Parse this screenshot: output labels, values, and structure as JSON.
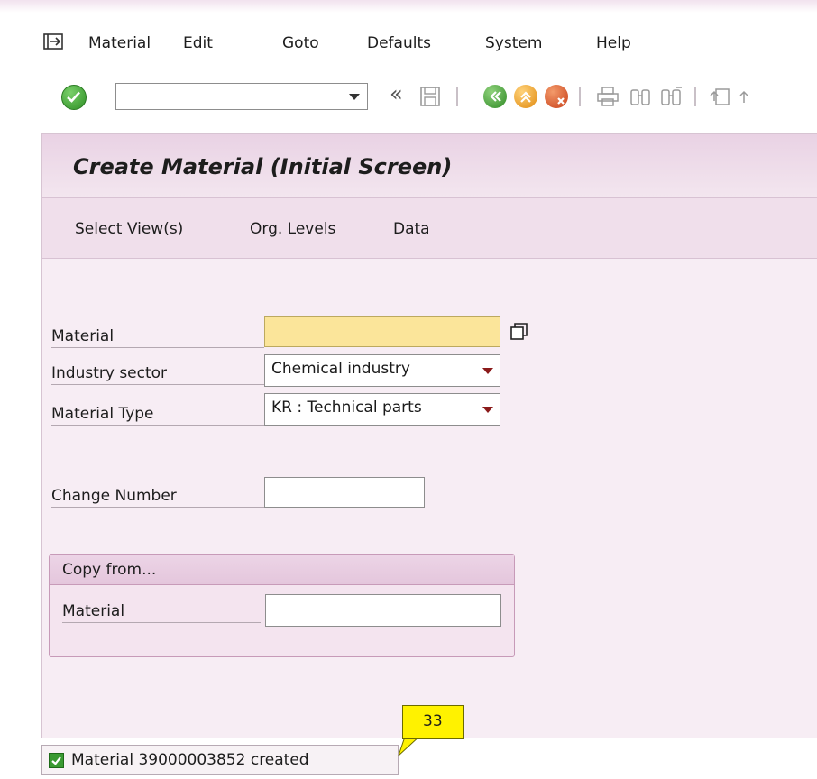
{
  "menu": {
    "items": [
      "Material",
      "Edit",
      "Goto",
      "Defaults",
      "System",
      "Help"
    ]
  },
  "toolbar": {
    "command_value": "",
    "icons": [
      "enter-icon",
      "command-field",
      "back-chevron-icon",
      "save-icon",
      "back-icon",
      "exit-icon",
      "cancel-icon",
      "print-icon",
      "find-icon",
      "find-next-icon",
      "first-page-icon"
    ]
  },
  "screen": {
    "title": "Create Material (Initial Screen)"
  },
  "actions": {
    "select_views": "Select View(s)",
    "org_levels": "Org. Levels",
    "data": "Data"
  },
  "form": {
    "material_label": "Material",
    "material_value": "",
    "industry_label": "Industry sector",
    "industry_value": "Chemical industry",
    "type_label": "Material Type",
    "type_value": "KR : Technical parts",
    "change_label": "Change Number",
    "change_value": ""
  },
  "copy_from": {
    "title": "Copy from...",
    "material_label": "Material",
    "material_value": ""
  },
  "status": {
    "message": "Material 39000003852 created"
  },
  "callout": {
    "number": "33"
  },
  "colors": {
    "title_bg": "#e9d2e4",
    "panel_bg": "#f7edf4",
    "required_field": "#fbe59a",
    "callout": "#fff200"
  }
}
